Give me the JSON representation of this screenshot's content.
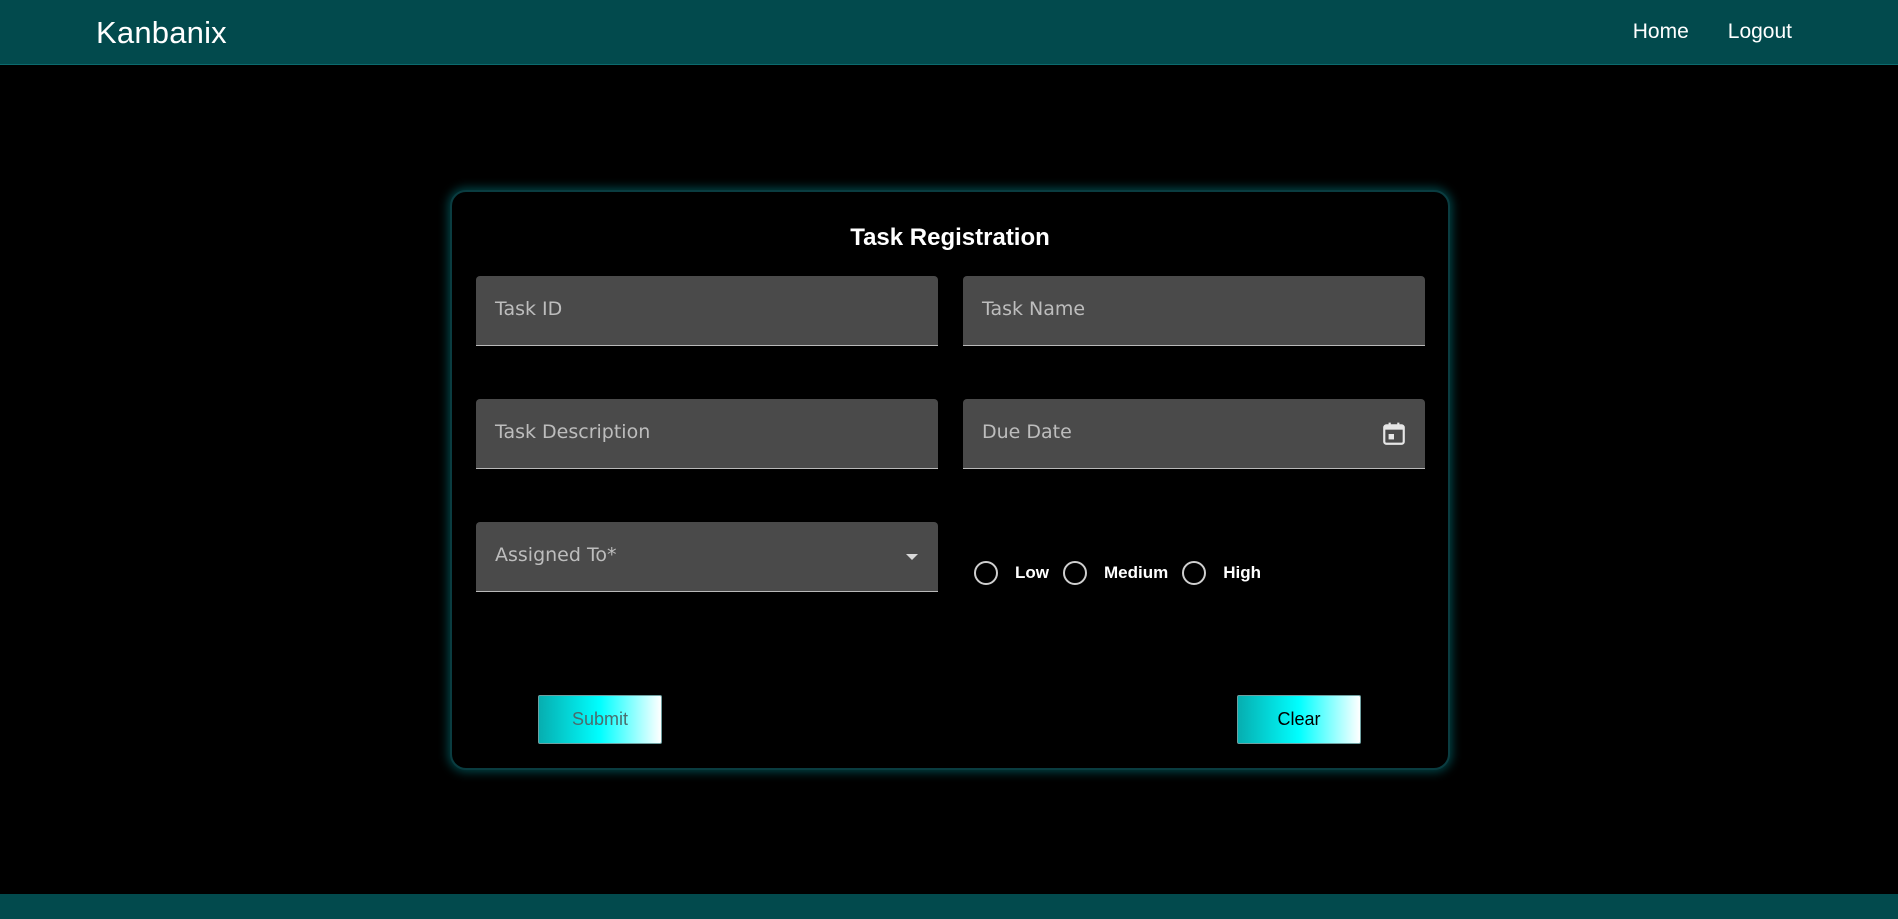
{
  "app": {
    "brand": "Kanbanix"
  },
  "nav": {
    "home": "Home",
    "logout": "Logout"
  },
  "form": {
    "title": "Task Registration",
    "task_id_label": "Task ID",
    "task_name_label": "Task Name",
    "task_description_label": "Task Description",
    "due_date_label": "Due Date",
    "assigned_to_label": "Assigned To*",
    "priority": {
      "low": "Low",
      "medium": "Medium",
      "high": "High"
    },
    "submit_label": "Submit",
    "clear_label": "Clear"
  },
  "icons": {
    "due_date": "calendar-icon",
    "assigned_to": "dropdown-arrow-icon"
  },
  "colors": {
    "header": "#024a4d",
    "field": "#4a4a4a",
    "accent": "#00ffff"
  }
}
